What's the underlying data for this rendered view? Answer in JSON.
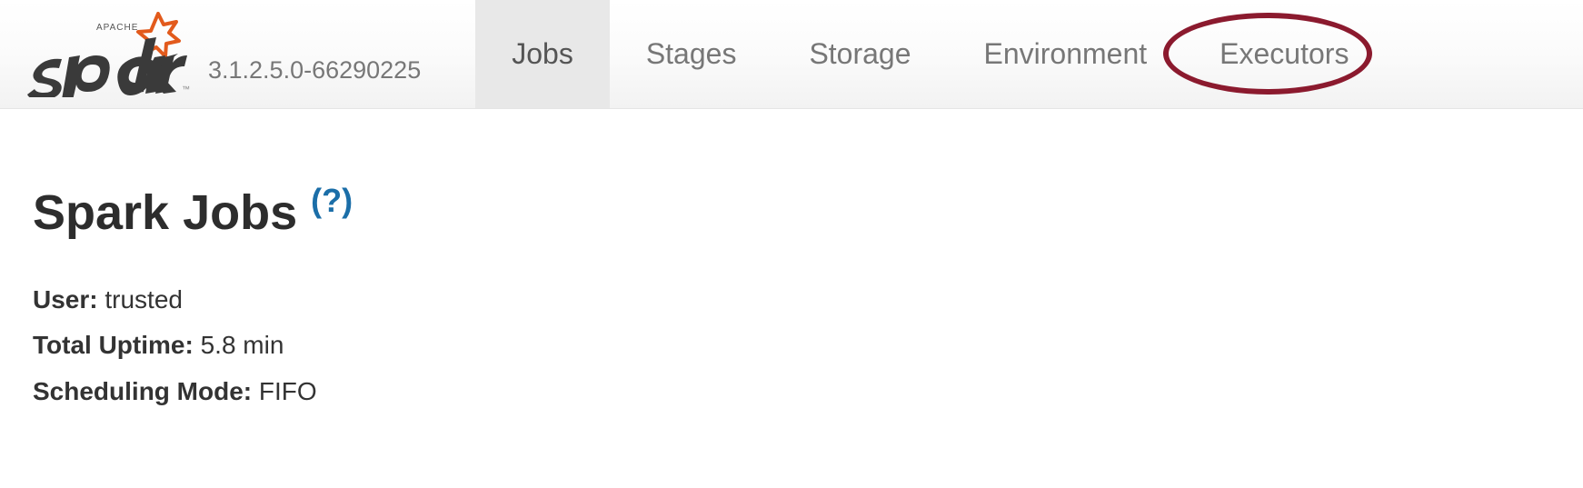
{
  "header": {
    "brand_alt": "Apache Spark",
    "version": "3.1.2.5.0-66290225",
    "tabs": [
      {
        "label": "Jobs",
        "active": true
      },
      {
        "label": "Stages",
        "active": false
      },
      {
        "label": "Storage",
        "active": false
      },
      {
        "label": "Environment",
        "active": false
      },
      {
        "label": "Executors",
        "active": false,
        "highlighted": true
      }
    ]
  },
  "page": {
    "title": "Spark Jobs ",
    "help_text": "(?)",
    "info": {
      "user_label": "User:",
      "user_value": "trusted",
      "uptime_label": "Total Uptime:",
      "uptime_value": "5.8 min",
      "sched_label": "Scheduling Mode:",
      "sched_value": "FIFO"
    }
  }
}
